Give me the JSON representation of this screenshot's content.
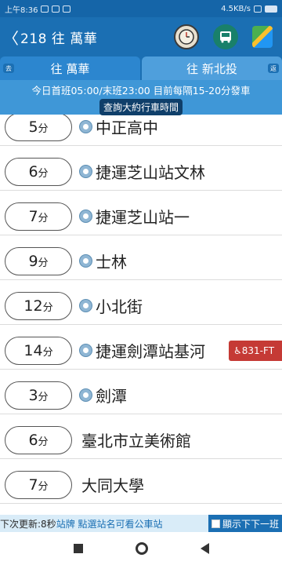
{
  "status_bar": {
    "time": "上午8:36",
    "speed": "4.5KB/s"
  },
  "header": {
    "back_glyph": "〈",
    "route_title": "218 往 萬華",
    "icons": [
      "clock-icon",
      "bus-icon",
      "map-icon"
    ]
  },
  "tabs": [
    {
      "label": "往 萬華",
      "badge": "去"
    },
    {
      "label": "往 新北投",
      "badge": "返"
    }
  ],
  "info": {
    "schedule": "今日首班05:00/末班23:00 目前每隔15-20分發車",
    "timetable_button": "查詢大約行車時間"
  },
  "stops": [
    {
      "eta": "5",
      "unit": "分",
      "name": "中正高中",
      "accessible": true
    },
    {
      "eta": "6",
      "unit": "分",
      "name": "捷運芝山站文林",
      "accessible": true
    },
    {
      "eta": "7",
      "unit": "分",
      "name": "捷運芝山站一",
      "accessible": true
    },
    {
      "eta": "9",
      "unit": "分",
      "name": "士林",
      "accessible": true
    },
    {
      "eta": "12",
      "unit": "分",
      "name": "小北街",
      "accessible": true
    },
    {
      "eta": "14",
      "unit": "分",
      "name": "捷運劍潭站基河",
      "accessible": true,
      "bus": "831-FT"
    },
    {
      "eta": "3",
      "unit": "分",
      "name": "劍潭",
      "accessible": true
    },
    {
      "eta": "6",
      "unit": "分",
      "name": "臺北市立美術館",
      "accessible": false
    },
    {
      "eta": "7",
      "unit": "分",
      "name": "大同大學",
      "accessible": false
    }
  ],
  "bottom": {
    "update_text": "下次更新:8秒",
    "hint_text": "站牌  點選站名可看公車站",
    "checkbox_label": "顯示下下一班"
  },
  "colors": {
    "primary": "#1b6fb3",
    "badge_red": "#c53a35"
  }
}
